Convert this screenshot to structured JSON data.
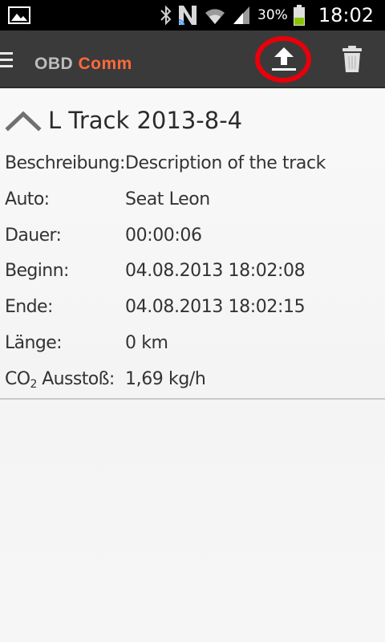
{
  "status_bar": {
    "battery_percent": "30%",
    "clock": "18:02",
    "icons": [
      "gallery-icon",
      "bluetooth-icon",
      "nfc-icon",
      "wifi-icon",
      "signal-icon",
      "battery-icon"
    ]
  },
  "action_bar": {
    "title_part1": "OBD",
    "title_part2": "Comm",
    "title_color_part1": "#bdbdbd",
    "title_color_part2": "#ff6a3a",
    "highlight_color": "#e8000a",
    "actions": [
      "upload-icon",
      "trash-icon"
    ]
  },
  "track": {
    "title": "L Track 2013-8-4",
    "fields": [
      {
        "label": "Beschreibung:",
        "value": "Description of the track"
      },
      {
        "label": "Auto:",
        "value": "Seat Leon"
      },
      {
        "label": "Dauer:",
        "value": "00:00:06"
      },
      {
        "label": "Beginn:",
        "value": "04.08.2013 18:02:08"
      },
      {
        "label": "Ende:",
        "value": "04.08.2013 18:02:15"
      },
      {
        "label": "Länge:",
        "value": "0 km"
      },
      {
        "label_prefix": "CO",
        "label_sub": "2",
        "label_suffix": " Ausstoß:",
        "value": "1,69 kg/h"
      }
    ]
  }
}
